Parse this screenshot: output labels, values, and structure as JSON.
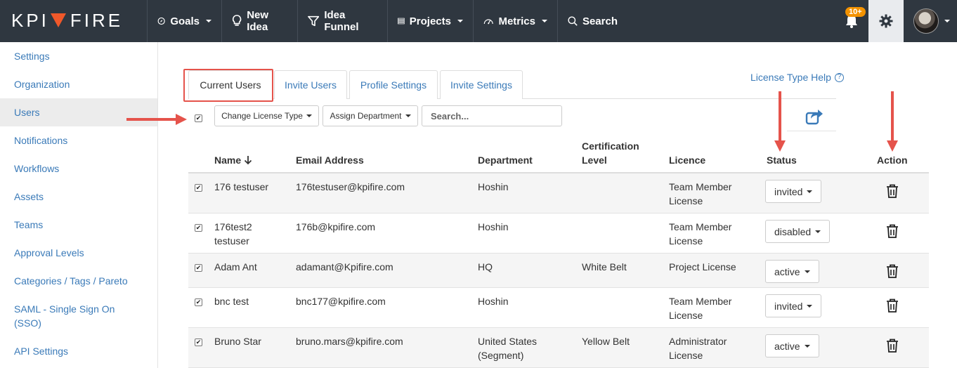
{
  "brand": {
    "logo_left": "KPI",
    "logo_right": "FIRE"
  },
  "nav": {
    "items": [
      {
        "label": "Goals",
        "icon": "compass-icon",
        "has_caret": true
      },
      {
        "label": "New Idea",
        "icon": "lightbulb-icon",
        "has_caret": false
      },
      {
        "label": "Idea Funnel",
        "icon": "funnel-icon",
        "has_caret": false
      },
      {
        "label": "Projects",
        "icon": "projects-icon",
        "has_caret": true
      },
      {
        "label": "Metrics",
        "icon": "gauge-icon",
        "has_caret": true
      },
      {
        "label": "Search",
        "icon": "search-icon",
        "has_caret": false
      }
    ],
    "notifications_badge": "10+"
  },
  "sidebar": {
    "items": [
      {
        "label": "Settings"
      },
      {
        "label": "Organization"
      },
      {
        "label": "Users",
        "active": true
      },
      {
        "label": "Notifications"
      },
      {
        "label": "Workflows"
      },
      {
        "label": "Assets"
      },
      {
        "label": "Teams"
      },
      {
        "label": "Approval Levels"
      },
      {
        "label": "Categories / Tags / Pareto"
      },
      {
        "label": "SAML - Single Sign On (SSO)"
      },
      {
        "label": "API Settings"
      }
    ]
  },
  "tabs": [
    {
      "label": "Current Users",
      "active": true
    },
    {
      "label": "Invite Users"
    },
    {
      "label": "Profile Settings"
    },
    {
      "label": "Invite Settings"
    }
  ],
  "license_help": "License Type Help",
  "toolbar": {
    "change_license": "Change License Type",
    "assign_department": "Assign Department",
    "search_placeholder": "Search..."
  },
  "table": {
    "headers": {
      "name": "Name",
      "email": "Email Address",
      "department": "Department",
      "certification": "Certification Level",
      "licence": "Licence",
      "status": "Status",
      "action": "Action"
    },
    "rows": [
      {
        "name": "176 testuser",
        "email": "176testuser@kpifire.com",
        "department": "Hoshin",
        "certification": "",
        "licence": "Team Member License",
        "status": "invited",
        "checked": true
      },
      {
        "name": "176test2 testuser",
        "email": "176b@kpifire.com",
        "department": "Hoshin",
        "certification": "",
        "licence": "Team Member License",
        "status": "disabled",
        "checked": true
      },
      {
        "name": "Adam Ant",
        "email": "adamant@Kpifire.com",
        "department": "HQ",
        "certification": "White Belt",
        "licence": "Project License",
        "status": "active",
        "checked": true
      },
      {
        "name": "bnc test",
        "email": "bnc177@kpifire.com",
        "department": "Hoshin",
        "certification": "",
        "licence": "Team Member License",
        "status": "invited",
        "checked": true
      },
      {
        "name": "Bruno Star",
        "email": "bruno.mars@kpifire.com",
        "department": "United States (Segment)",
        "certification": "Yellow Belt",
        "licence": "Administrator License",
        "status": "active",
        "checked": true
      }
    ]
  },
  "colors": {
    "navbar": "#2f3740",
    "link": "#3a7ab8",
    "accent_orange": "#f0582a",
    "badge": "#f39200",
    "annotation_red": "#e5534b"
  }
}
